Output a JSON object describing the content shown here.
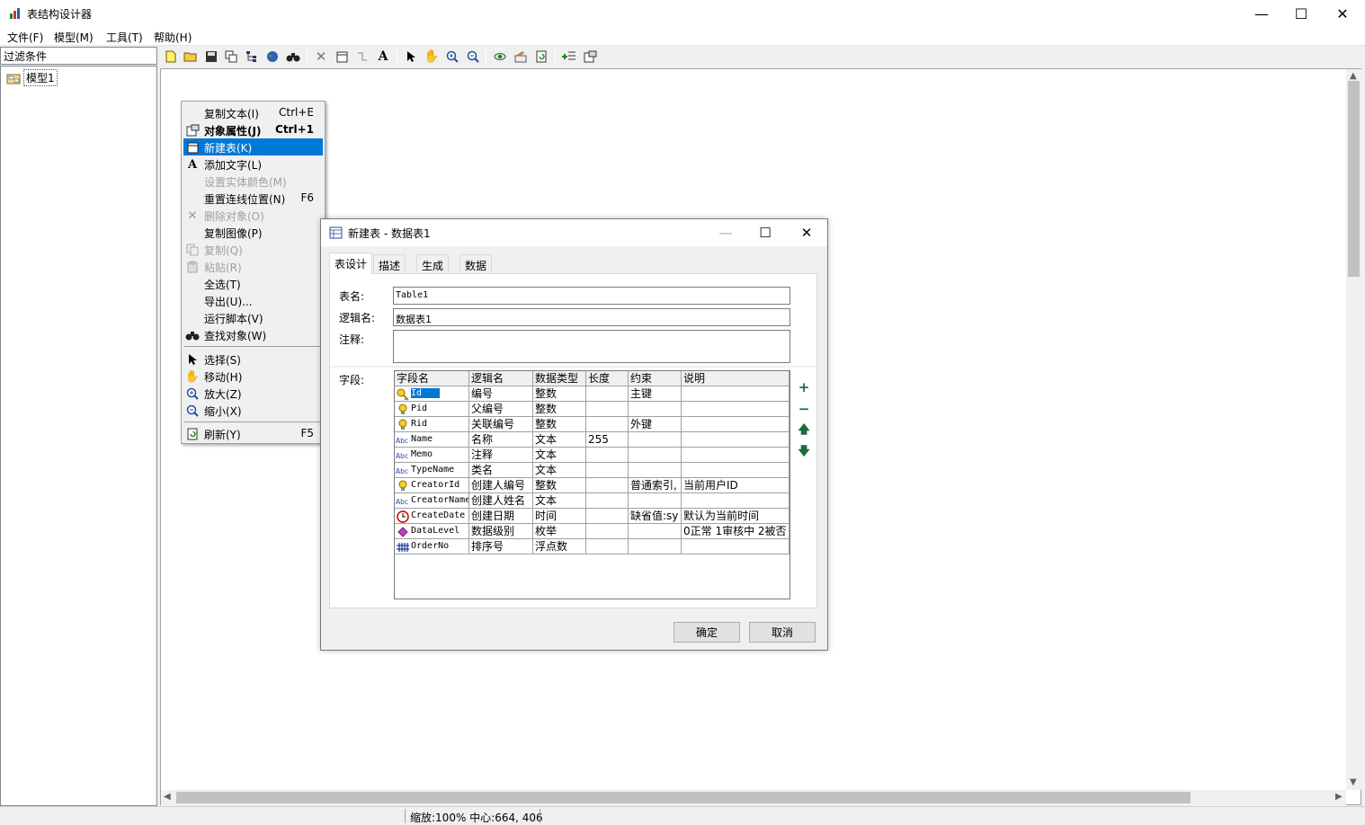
{
  "app": {
    "title": "表结构设计器"
  },
  "menus": [
    "文件(F)",
    "模型(M)",
    "工具(T)",
    "帮助(H)"
  ],
  "filter": {
    "label": "过滤条件"
  },
  "tree": {
    "item": "模型1"
  },
  "toolbar": {
    "icons": [
      "new-file-icon",
      "open-folder-icon",
      "save-icon",
      "copy-windows-icon",
      "tree-structure-icon",
      "globe-icon",
      "binoculars-icon",
      "delete-x-icon",
      "table-icon",
      "connector-icon",
      "text-a-icon",
      "select-arrow-icon",
      "hand-icon",
      "zoom-in-icon",
      "zoom-out-icon",
      "eye-icon",
      "image-edit-icon",
      "refresh-page-icon",
      "add-list-icon",
      "properties-icon"
    ]
  },
  "context_menu": {
    "items": [
      {
        "label": "复制文本(I)",
        "shortcut": "Ctrl+E",
        "disabled": false,
        "bold": false
      },
      {
        "label": "对象属性(J)",
        "shortcut": "Ctrl+1",
        "disabled": false,
        "bold": true
      },
      {
        "label": "新建表(K)",
        "shortcut": "",
        "disabled": false,
        "bold": false
      },
      {
        "label": "添加文字(L)",
        "shortcut": "",
        "disabled": false,
        "bold": false
      },
      {
        "label": "设置实体颜色(M)",
        "shortcut": "",
        "disabled": true,
        "bold": false
      },
      {
        "label": "重置连线位置(N)",
        "shortcut": "F6",
        "disabled": false,
        "bold": false
      },
      {
        "label": "删除对象(O)",
        "shortcut": "",
        "disabled": true,
        "bold": false
      },
      {
        "label": "复制图像(P)",
        "shortcut": "",
        "disabled": false,
        "bold": false
      },
      {
        "label": "复制(Q)",
        "shortcut": "",
        "disabled": true,
        "bold": false
      },
      {
        "label": "粘贴(R)",
        "shortcut": "",
        "disabled": true,
        "bold": false
      },
      {
        "label": "全选(T)",
        "shortcut": "",
        "disabled": false,
        "bold": false
      },
      {
        "label": "导出(U)...",
        "shortcut": "",
        "disabled": false,
        "bold": false
      },
      {
        "label": "运行脚本(V)",
        "shortcut": "",
        "disabled": false,
        "bold": false
      },
      {
        "label": "查找对象(W)",
        "shortcut": "",
        "disabled": false,
        "bold": false
      },
      {
        "label": "选择(S)",
        "shortcut": "",
        "disabled": false,
        "bold": false
      },
      {
        "label": "移动(H)",
        "shortcut": "",
        "disabled": false,
        "bold": false
      },
      {
        "label": "放大(Z)",
        "shortcut": "",
        "disabled": false,
        "bold": false
      },
      {
        "label": "缩小(X)",
        "shortcut": "",
        "disabled": false,
        "bold": false
      },
      {
        "label": "刷新(Y)",
        "shortcut": "F5",
        "disabled": false,
        "bold": false
      }
    ],
    "highlighted": "新建表(K)"
  },
  "dialog": {
    "title": "新建表 - 数据表1",
    "tabs": [
      "表设计",
      "描述",
      "生成",
      "数据"
    ],
    "active_tab": "表设计",
    "table_name_label": "表名:",
    "table_name": "Table1",
    "logical_name_label": "逻辑名:",
    "logical_name": "数据表1",
    "comment_label": "注释:",
    "comment": "",
    "fields_label": "字段:",
    "columns": [
      "字段名",
      "逻辑名",
      "数据类型",
      "长度",
      "约束",
      "说明"
    ],
    "rows": [
      {
        "icon": "key-icon",
        "name": "Id",
        "logical": "编号",
        "type": "整数",
        "length": "",
        "constraint": "主键",
        "desc": ""
      },
      {
        "icon": "bulb-icon",
        "name": "Pid",
        "logical": "父编号",
        "type": "整数",
        "length": "",
        "constraint": "",
        "desc": ""
      },
      {
        "icon": "bulb-icon",
        "name": "Rid",
        "logical": "关联编号",
        "type": "整数",
        "length": "",
        "constraint": "外键",
        "desc": ""
      },
      {
        "icon": "text-type-icon",
        "name": "Name",
        "logical": "名称",
        "type": "文本",
        "length": "255",
        "constraint": "",
        "desc": ""
      },
      {
        "icon": "text-type-icon",
        "name": "Memo",
        "logical": "注释",
        "type": "文本",
        "length": "",
        "constraint": "",
        "desc": ""
      },
      {
        "icon": "text-type-icon",
        "name": "TypeName",
        "logical": "类名",
        "type": "文本",
        "length": "",
        "constraint": "",
        "desc": ""
      },
      {
        "icon": "bulb-icon",
        "name": "CreatorId",
        "logical": "创建人编号",
        "type": "整数",
        "length": "",
        "constraint": "普通索引,",
        "desc": "当前用户ID"
      },
      {
        "icon": "text-type-icon",
        "name": "CreatorName",
        "logical": "创建人姓名",
        "type": "文本",
        "length": "",
        "constraint": "",
        "desc": ""
      },
      {
        "icon": "clock-icon",
        "name": "CreateDate",
        "logical": "创建日期",
        "type": "时间",
        "length": "",
        "constraint": "缺省值:sy",
        "desc": "默认为当前时间"
      },
      {
        "icon": "diamond-icon",
        "name": "DataLevel",
        "logical": "数据级别",
        "type": "枚举",
        "length": "",
        "constraint": "",
        "desc": "0正常 1审核中 2被否"
      },
      {
        "icon": "hash-icon",
        "name": "OrderNo",
        "logical": "排序号",
        "type": "浮点数",
        "length": "",
        "constraint": "",
        "desc": ""
      }
    ],
    "ok_label": "确定",
    "cancel_label": "取消"
  },
  "status": {
    "text": "缩放:100% 中心:664, 406"
  }
}
